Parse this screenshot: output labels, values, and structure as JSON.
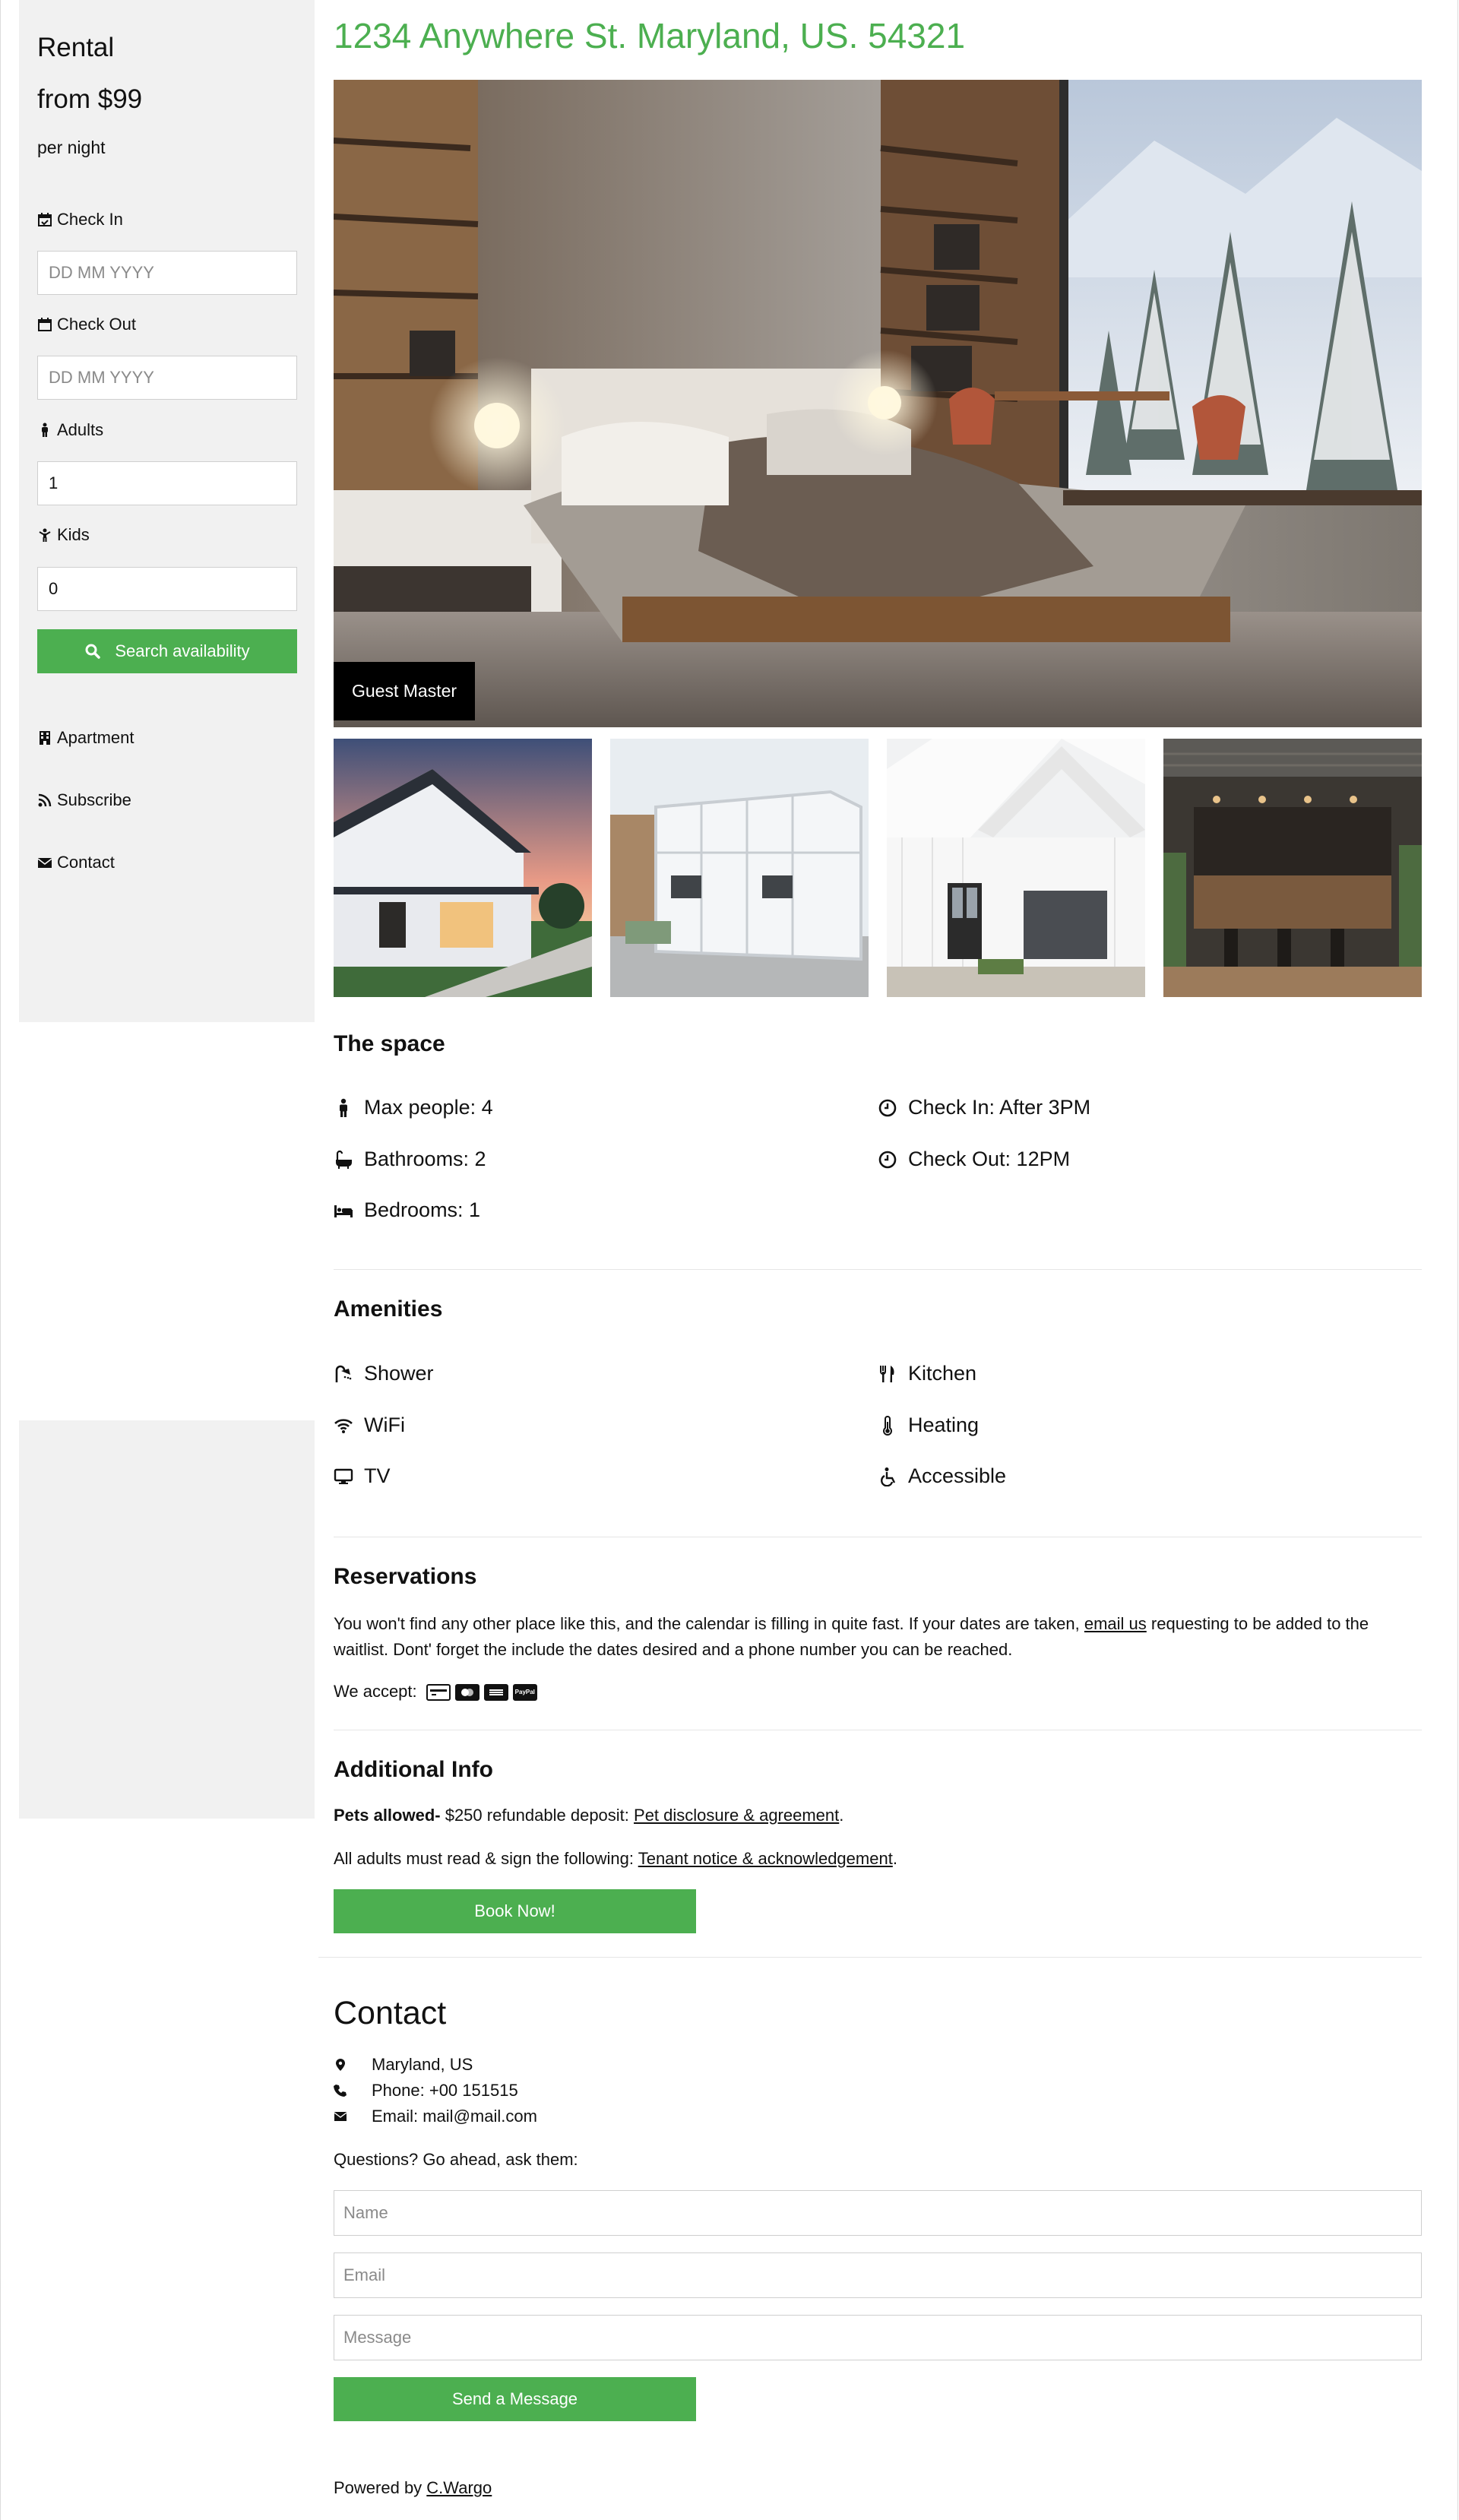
{
  "sidebar": {
    "title": "Rental",
    "price": "from $99",
    "price_unit": "per night",
    "check_in": {
      "label": "Check In",
      "placeholder": "DD MM YYYY"
    },
    "check_out": {
      "label": "Check Out",
      "placeholder": "DD MM YYYY"
    },
    "adults": {
      "label": "Adults",
      "value": "1"
    },
    "kids": {
      "label": "Kids",
      "value": "0"
    },
    "search_button": "Search availability",
    "nav": [
      "Apartment",
      "Subscribe",
      "Contact"
    ]
  },
  "main": {
    "address": "1234 Anywhere St. Maryland, US. 54321",
    "hero_label": "Guest Master",
    "space": {
      "title": "The space",
      "left": [
        "Max people: 4",
        "Bathrooms: 2",
        "Bedrooms: 1"
      ],
      "right": [
        "Check In: After 3PM",
        "Check Out: 12PM"
      ]
    },
    "amenities": {
      "title": "Amenities",
      "left": [
        "Shower",
        "WiFi",
        "TV"
      ],
      "right": [
        "Kitchen",
        "Heating",
        "Accessible"
      ]
    },
    "reservations": {
      "title": "Reservations",
      "text_before": "You won't find any other place like this, and the calendar is filling in quite fast. If your dates are taken, ",
      "link": "email us",
      "text_after": " requesting to be added to the waitlist. Dont' forget the include the dates desired and a phone number you can be reached.",
      "accept": "We accept:",
      "card_labels": [
        "",
        "",
        "",
        "PayPal"
      ]
    },
    "additional": {
      "title": "Additional Info",
      "pets_bold": "Pets allowed-",
      "pets_text": " $250 refundable deposit: ",
      "pets_link": "Pet disclosure & agreement",
      "adults_text": "All adults must read & sign the following: ",
      "adults_link": "Tenant notice & acknowledgement",
      "period": ".",
      "book_button": "Book Now!"
    },
    "contact": {
      "title": "Contact",
      "location": "Maryland, US",
      "phone": "Phone: +00 151515",
      "email": "Email: mail@mail.com",
      "questions": "Questions? Go ahead, ask them:",
      "name_placeholder": "Name",
      "email_placeholder": "Email",
      "message_placeholder": "Message",
      "send_button": "Send a Message"
    },
    "footer": {
      "prefix": "Powered by ",
      "link": "C.Wargo"
    }
  },
  "colors": {
    "accent": "#4caf50",
    "sidebar_bg": "#f1f1f1"
  }
}
